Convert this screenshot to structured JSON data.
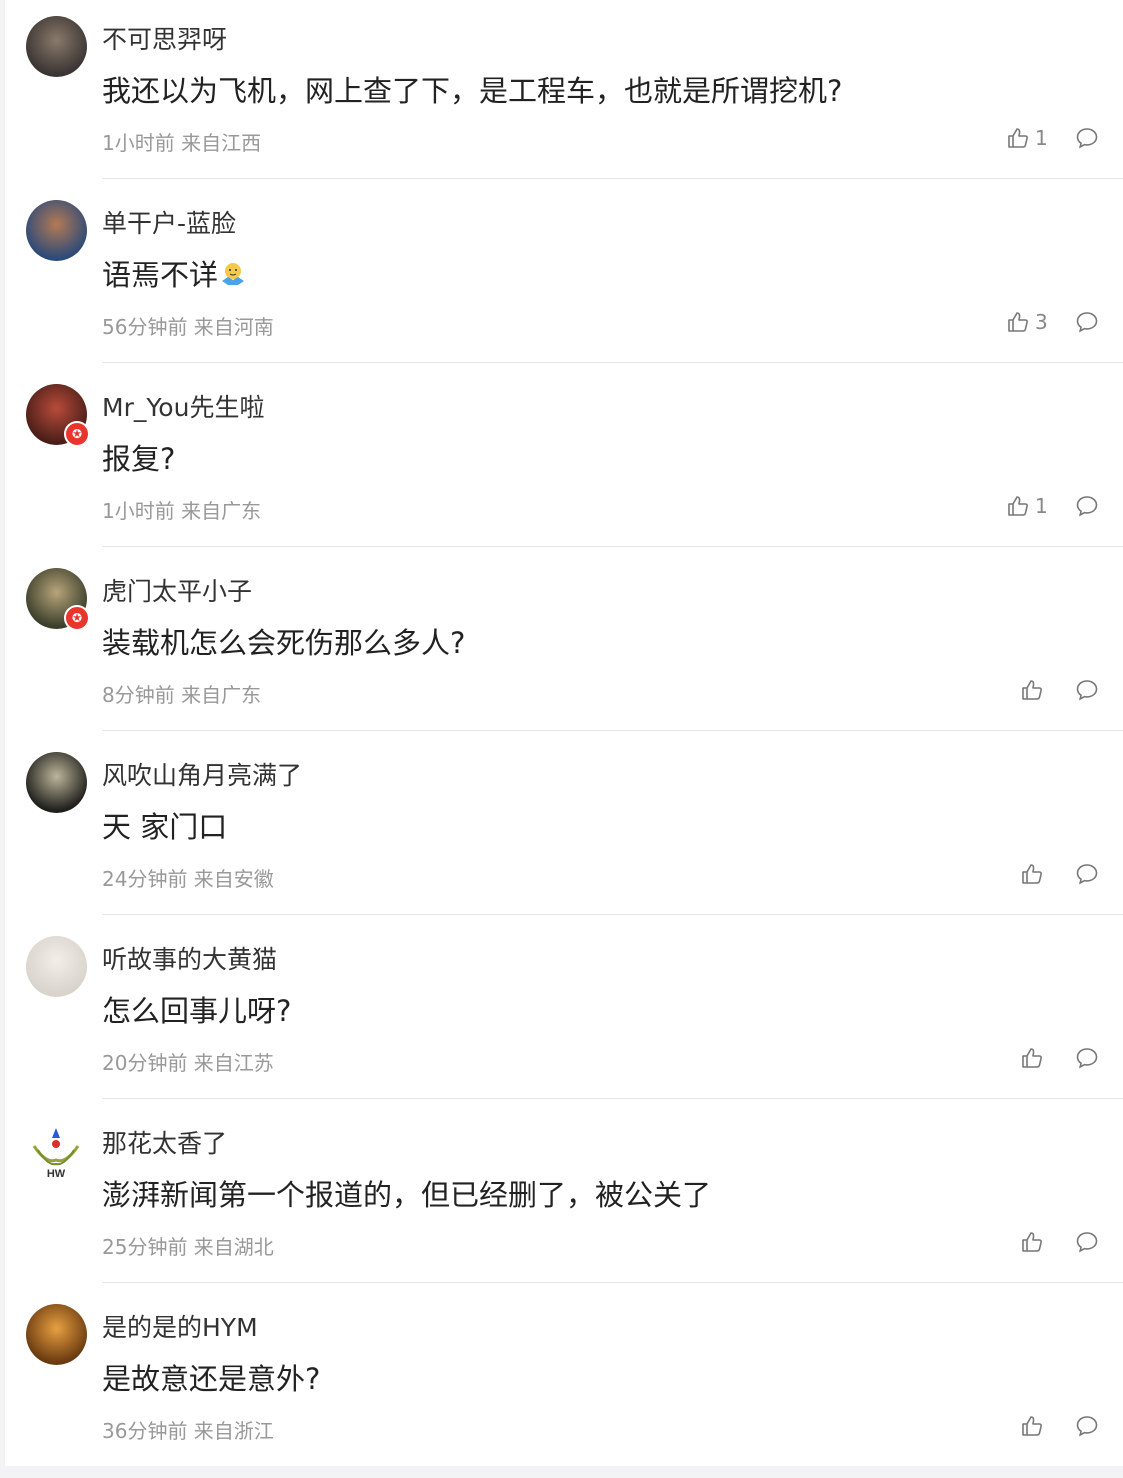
{
  "comments": [
    {
      "username": "不可思羿呀",
      "text": "我还以为飞机，网上查了下，是工程车，也就是所谓挖机?",
      "meta": "1小时前 来自江西",
      "likes": "1",
      "avatar_icon": "user-avatar-icon",
      "colors": [
        "#3a3433",
        "#8a7a6a"
      ]
    },
    {
      "username": "单干户-蓝脸",
      "text": "语焉不详",
      "meta": "56分钟前 来自河南",
      "likes": "3",
      "avatar_icon": "user-avatar-icon",
      "colors": [
        "#2c4a78",
        "#b47a55"
      ]
    },
    {
      "username": "Mr_You先生啦",
      "text": "报复?",
      "meta": "1小时前 来自广东",
      "likes": "1",
      "avatar_icon": "user-avatar-icon",
      "badge_icon": "verified-star-icon",
      "colors": [
        "#4a1e18",
        "#b84b3a"
      ]
    },
    {
      "username": "虎门太平小子",
      "text": "装载机怎么会死伤那么多人?",
      "meta": "8分钟前 来自广东",
      "likes": "",
      "avatar_icon": "user-avatar-icon",
      "badge_icon": "verified-star-icon",
      "colors": [
        "#3b3f2b",
        "#b8a47a"
      ]
    },
    {
      "username": "风吹山角月亮满了",
      "text": "天 家门口",
      "meta": "24分钟前 来自安徽",
      "likes": "",
      "avatar_icon": "user-avatar-icon",
      "colors": [
        "#1f1f1c",
        "#bdb59a"
      ]
    },
    {
      "username": "听故事的大黄猫",
      "text": "怎么回事儿呀?",
      "meta": "20分钟前 来自江苏",
      "likes": "",
      "avatar_icon": "user-avatar-icon",
      "colors": [
        "#d8d4cc",
        "#f2eee8"
      ]
    },
    {
      "username": "那花太香了",
      "text": "澎湃新闻第一个报道的，但已经删了，被公关了",
      "meta": "25分钟前 来自湖北",
      "likes": "",
      "avatar_icon": "user-avatar-icon",
      "colors": [
        "#ffffff",
        "#ffffff"
      ],
      "avatar_text": "HW"
    },
    {
      "username": "是的是的HYM",
      "text": "是故意还是意外?",
      "meta": "36分钟前 来自浙江",
      "likes": "",
      "avatar_icon": "user-avatar-icon",
      "colors": [
        "#6a3a10",
        "#e8a040"
      ]
    }
  ],
  "icons": {
    "like": "thumbs-up-icon",
    "reply": "comment-bubble-icon",
    "emoji": "shrug-emoji-icon"
  }
}
